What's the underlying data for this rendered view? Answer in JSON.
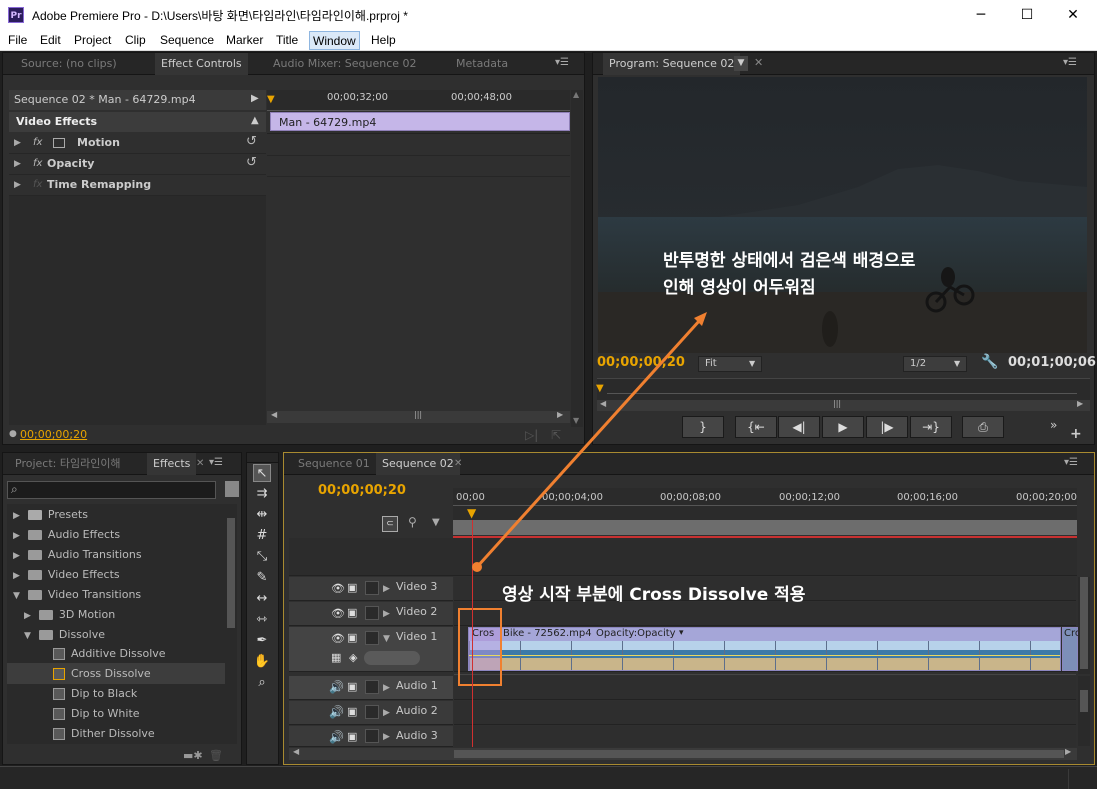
{
  "window": {
    "app_icon": "Pr",
    "title": "Adobe Premiere Pro - D:\\Users\\바탕 화면\\타임라인\\타임라인이해.prproj *",
    "minimize_icon": "─",
    "maximize_icon": "☐",
    "close_icon": "✕"
  },
  "menu": [
    "File",
    "Edit",
    "Project",
    "Clip",
    "Sequence",
    "Marker",
    "Title",
    "Window",
    "Help"
  ],
  "top_left_panel": {
    "tabs": [
      "Source: (no clips)",
      "Effect Controls",
      "Audio Mixer: Sequence 02",
      "Metadata"
    ],
    "clip_header": "Sequence 02 * Man - 64729.mp4",
    "section": "Video Effects",
    "effects": [
      "Motion",
      "Opacity",
      "Time Remapping"
    ],
    "ruler_times": [
      "00;00;32;00",
      "00;00;48;00"
    ],
    "clip_bar_label": "Man - 64729.mp4",
    "timecode": "00;00;00;20",
    "fx_symbol": "fx"
  },
  "program_monitor": {
    "tab": "Program: Sequence 02",
    "timecode": "00;00;00;20",
    "fit_label": "Fit",
    "resolution_label": "1/2",
    "duration": "00;01;00;06"
  },
  "project_panel": {
    "tabs": [
      "Project: 타임라인이해",
      "Effects"
    ],
    "tree": [
      {
        "label": "Presets",
        "depth": 0,
        "type": "folder"
      },
      {
        "label": "Audio Effects",
        "depth": 0,
        "type": "folder"
      },
      {
        "label": "Audio Transitions",
        "depth": 0,
        "type": "folder"
      },
      {
        "label": "Video Effects",
        "depth": 0,
        "type": "folder"
      },
      {
        "label": "Video Transitions",
        "depth": 0,
        "type": "folder"
      },
      {
        "label": "3D Motion",
        "depth": 1,
        "type": "folder"
      },
      {
        "label": "Dissolve",
        "depth": 1,
        "type": "folder"
      },
      {
        "label": "Additive Dissolve",
        "depth": 2,
        "type": "fx"
      },
      {
        "label": "Cross Dissolve",
        "depth": 2,
        "type": "fx"
      },
      {
        "label": "Dip to Black",
        "depth": 2,
        "type": "fx"
      },
      {
        "label": "Dip to White",
        "depth": 2,
        "type": "fx"
      },
      {
        "label": "Dither Dissolve",
        "depth": 2,
        "type": "fx"
      }
    ]
  },
  "timeline": {
    "tabs": [
      "Sequence 01",
      "Sequence 02"
    ],
    "timecode": "00;00;00;20",
    "ruler": [
      "00;00",
      "00;00;04;00",
      "00;00;08;00",
      "00;00;12;00",
      "00;00;16;00",
      "00;00;20;00"
    ],
    "video_tracks": [
      "Video 3",
      "Video 2",
      "Video 1"
    ],
    "audio_tracks": [
      "Audio 1",
      "Audio 2",
      "Audio 3"
    ],
    "clip_transition": "Cros",
    "clip_name": "Bike - 72562.mp4",
    "clip_fx": "Opacity:Opacity",
    "clip_end": "Cro"
  },
  "annotations": {
    "monitor_note_line1": "반투명한 상태에서 검은색 배경으로",
    "monitor_note_line2": "인해 영상이 어두워짐",
    "timeline_note": "영상 시작 부분에 Cross Dissolve 적용"
  },
  "colors": {
    "accent_timecode": "#e8a400",
    "clip_bar": "#c5b6e8",
    "annotation_arrow": "#f08030",
    "playhead": "#d03030"
  }
}
